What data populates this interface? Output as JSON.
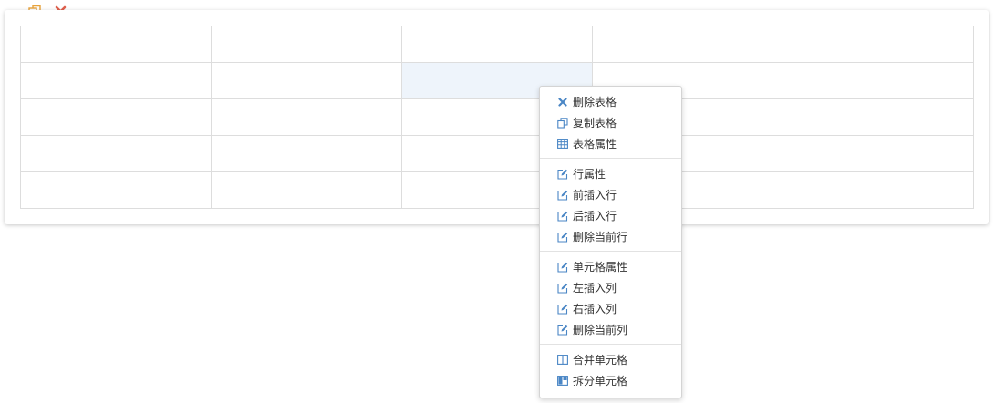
{
  "toolbar": {
    "copy_icon": "copy-icon",
    "delete_icon": "close-icon"
  },
  "grid": {
    "rows": 5,
    "cols": 5,
    "selected_row": 1,
    "selected_col": 2
  },
  "context_menu": {
    "groups": [
      {
        "items": [
          {
            "label": "删除表格",
            "icon": "close-icon"
          },
          {
            "label": "复制表格",
            "icon": "copy-icon"
          },
          {
            "label": "表格属性",
            "icon": "table-icon"
          }
        ]
      },
      {
        "items": [
          {
            "label": "行属性",
            "icon": "edit-icon"
          },
          {
            "label": "前插入行",
            "icon": "edit-icon"
          },
          {
            "label": "后插入行",
            "icon": "edit-icon"
          },
          {
            "label": "删除当前行",
            "icon": "edit-icon"
          }
        ]
      },
      {
        "items": [
          {
            "label": "单元格属性",
            "icon": "edit-icon"
          },
          {
            "label": "左插入列",
            "icon": "edit-icon"
          },
          {
            "label": "右插入列",
            "icon": "edit-icon"
          },
          {
            "label": "删除当前列",
            "icon": "edit-icon"
          }
        ]
      },
      {
        "items": [
          {
            "label": "合并单元格",
            "icon": "merge-cells-icon"
          },
          {
            "label": "拆分单元格",
            "icon": "split-cells-icon"
          }
        ]
      }
    ]
  },
  "colors": {
    "accent": "#4a86c5",
    "copy_icon": "#e8a33c",
    "delete_icon": "#e0604d",
    "selected_cell": "#eef4fb"
  }
}
